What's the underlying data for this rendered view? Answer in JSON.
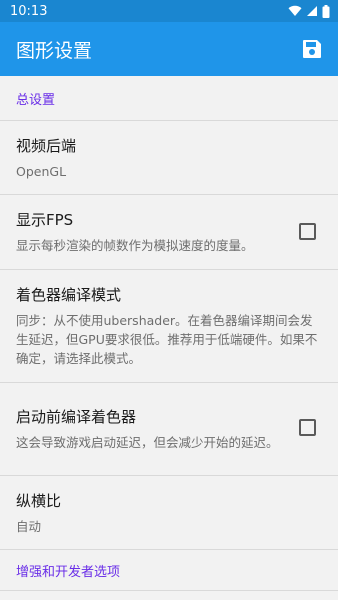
{
  "status_bar": {
    "time": "10:13"
  },
  "app_bar": {
    "title": "图形设置",
    "save_icon": "save-icon"
  },
  "sections": {
    "general": {
      "header": "总设置"
    },
    "enhancements": {
      "header": "增强和开发者选项"
    }
  },
  "items": {
    "video_backend": {
      "title": "视频后端",
      "summary": "OpenGL"
    },
    "show_fps": {
      "title": "显示FPS",
      "summary": "显示每秒渲染的帧数作为模拟速度的度量。",
      "checked": false
    },
    "shader_mode": {
      "title": "着色器编译模式",
      "summary": "同步：从不使用ubershader。在着色器编译期间会发生延迟，但GPU要求很低。推荐用于低端硬件。如果不确定，请选择此模式。"
    },
    "precompile_shaders": {
      "title": "启动前编译着色器",
      "summary": "这会导致游戏启动延迟，但会减少开始的延迟。",
      "checked": false
    },
    "aspect_ratio": {
      "title": "纵横比",
      "summary": "自动"
    }
  },
  "colors": {
    "status_bar": "#1a86d0",
    "app_bar": "#1f95e9",
    "section_header": "#6a2ee8"
  }
}
